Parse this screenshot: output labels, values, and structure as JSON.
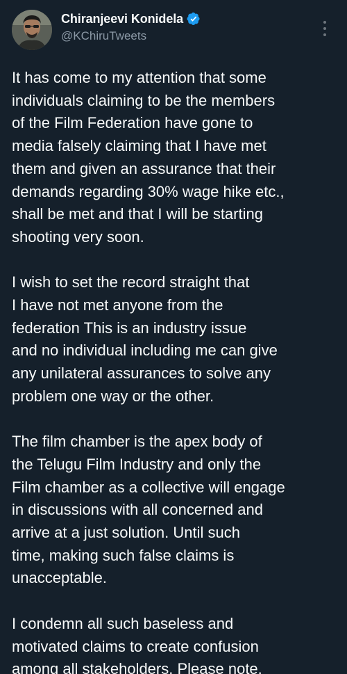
{
  "author": {
    "display_name": "Chiranjeevi Konidela",
    "handle": "@KChiruTweets",
    "verified": true,
    "verified_color": "#1d9bf0"
  },
  "icons": {
    "verified": "verified-badge-icon",
    "more": "more-vertical-icon"
  },
  "tweet": {
    "paragraphs": [
      "It has come to my attention that some\nindividuals claiming to be the members\nof the Film Federation have gone to\nmedia falsely claiming that I have met\nthem and given an assurance that their\ndemands regarding  30% wage hike etc.,\nshall be met and that I will be starting\nshooting very soon.",
      "I wish to set the record straight that\nI have not met anyone from the\nfederation This is an industry issue\nand no individual including me can give\nany unilateral assurances to solve any\nproblem one way or the other.",
      "The film chamber is the apex body of\nthe Telugu Film Industry and only the\nFilm chamber as a collective will engage\nin discussions with all concerned and\narrive at a just solution. Until such\ntime, making such false claims is\nunacceptable.",
      "I condemn all such baseless and\nmotivated claims to create confusion\namong all stakeholders. Please note."
    ]
  },
  "theme": {
    "background": "#15202b",
    "text": "#f7f9f9",
    "secondary_text": "#8b98a5"
  }
}
